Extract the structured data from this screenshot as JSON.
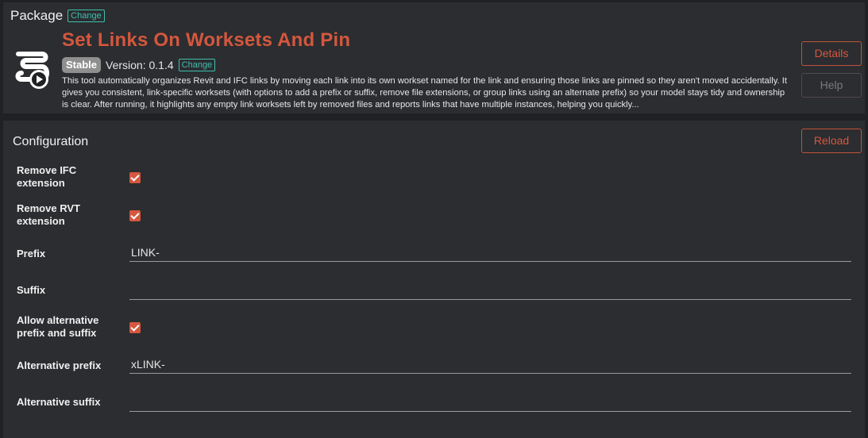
{
  "package": {
    "header_label": "Package",
    "change_label": "Change",
    "logo_icon": "revit-script-play-icon",
    "tool_title": "Set Links On Worksets And Pin",
    "status_badge": "Stable",
    "version_text": "Version: 0.1.4",
    "version_change_label": "Change",
    "description": "This tool automatically organizes Revit and IFC links by moving each link into its own workset named for the link and ensuring those links are pinned so they aren't moved accidentally. It gives you consistent, link-specific worksets (with options to add a prefix or suffix, remove file extensions, or group links using an alternate prefix) so your model stays tidy and ownership is clear. After running, it highlights any empty link worksets left by removed files and reports links that have multiple instances, helping you quickly...",
    "details_label": "Details",
    "help_label": "Help"
  },
  "configuration": {
    "title": "Configuration",
    "reload_label": "Reload",
    "remove_ifc": {
      "label_line1": "Remove IFC",
      "label_line2": "extension",
      "checked": true
    },
    "remove_rvt": {
      "label_line1": "Remove RVT",
      "label_line2": "extension",
      "checked": true
    },
    "prefix": {
      "label": "Prefix",
      "value": "LINK-"
    },
    "suffix": {
      "label": "Suffix",
      "value": ""
    },
    "allow_alt": {
      "label_line1": "Allow alternative",
      "label_line2": "prefix and suffix",
      "checked": true
    },
    "alt_prefix": {
      "label": "Alternative prefix",
      "value": "xLINK-"
    },
    "alt_suffix": {
      "label": "Alternative suffix",
      "value": ""
    }
  },
  "colors": {
    "accent": "#d4573e",
    "badge_teal": "#3fbfae",
    "panel_bg": "#2b2d30",
    "page_bg": "#1f2124"
  }
}
